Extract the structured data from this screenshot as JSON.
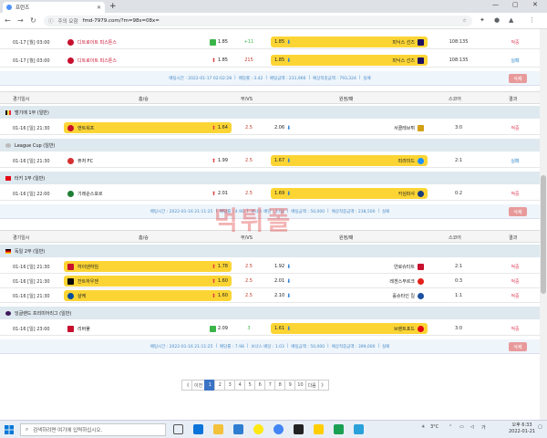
{
  "browser": {
    "tab_title": "프런즈",
    "new_tab": "+",
    "security_label": "주의 요함",
    "url": "fmd-7979.com/?m=98s=08x=",
    "win_min": "—",
    "win_max": "▢",
    "win_close": "✕"
  },
  "top_rows": [
    {
      "date": "01-17 [월] 03:00",
      "home": "디트로이트 피스톤스",
      "home_odds": "1.85",
      "draw": "+11",
      "away_odds": "1.85",
      "away": "피닉스 선즈",
      "score": "108:135",
      "result": "적중",
      "result_color": "red"
    },
    {
      "date": "01-17 [월] 03:00",
      "home": "디트로이트 피스톤스",
      "home_odds": "1.85",
      "draw": "215",
      "away_odds": "1.85",
      "away": "피닉스 선즈",
      "score": "108:135",
      "result": "실패",
      "result_color": "blue"
    }
  ],
  "summary1": {
    "time": "배팅시간 : 2022-01-17 02:02:28",
    "rate": "배당률 : 3.42",
    "amount": "배팅금액 : 231,966",
    "expected": "예상적중금액 : 793,324",
    "status": "실패",
    "delete": "삭제"
  },
  "header": {
    "date": "경기일시",
    "home": "홈/승",
    "draw": "무/VS",
    "away": "원정/패",
    "score": "스코어",
    "result": "결과"
  },
  "block2": {
    "leagues": [
      {
        "name": "벨기에 1부 (일반)",
        "color": "#222",
        "row": {
          "date": "01-16 [일] 21:30",
          "home": "앤트워프",
          "home_odds": "1.64",
          "draw": "2.5",
          "away_odds": "2.06",
          "away": "서클레브뤼",
          "score": "3:0",
          "result": "적중",
          "result_color": "red",
          "home_y": true,
          "away_y": false
        }
      },
      {
        "name": "League Cup (일반)",
        "color": "#777",
        "row": {
          "date": "01-16 [일] 21:30",
          "home": "퓨처 FC",
          "home_odds": "1.99",
          "draw": "2.5",
          "away_odds": "1.67",
          "away": "피라미드",
          "score": "2:1",
          "result": "실패",
          "result_color": "blue",
          "home_y": false,
          "away_y": true
        }
      },
      {
        "name": "터키 1부 (일반)",
        "color": "#e30a17",
        "row": {
          "date": "01-16 [일] 22:00",
          "home": "기레순스포르",
          "home_odds": "2.01",
          "draw": "2.5",
          "away_odds": "1.69",
          "away": "카심파샤",
          "score": "0:2",
          "result": "적중",
          "result_color": "red",
          "home_y": false,
          "away_y": true
        }
      }
    ],
    "summary": {
      "time": "배팅시간 : 2022-01-16 21:11:25",
      "rate": "배당률 : 4.90",
      "bonus": "보너스 배당 : 1.03",
      "amount": "배팅금액 : 50,000",
      "expected": "예상적중금액 : 238,500",
      "status": "실패",
      "delete": "삭제"
    }
  },
  "block3": {
    "league1": {
      "name": "독일 2부 (일반)",
      "color": "#dd0000"
    },
    "rows1": [
      {
        "date": "01-16 [일] 21:30",
        "home": "하이덴하임",
        "home_odds": "1.78",
        "draw": "2.5",
        "away_odds": "1.92",
        "away": "얀로슈타트",
        "score": "2:1",
        "result": "적중",
        "result_color": "red",
        "home_y": true,
        "away_y": false
      },
      {
        "date": "01-16 [일] 21:30",
        "home": "잔트하우젠",
        "home_odds": "1.60",
        "draw": "2.5",
        "away_odds": "2.01",
        "away": "레겐스부르크",
        "score": "0:3",
        "result": "적중",
        "result_color": "red",
        "home_y": true,
        "away_y": false
      },
      {
        "date": "01-16 [일] 21:30",
        "home": "샬케",
        "home_odds": "1.60",
        "draw": "2.5",
        "away_odds": "2.10",
        "away": "홀슈타인 킬",
        "score": "1:1",
        "result": "적중",
        "result_color": "red",
        "home_y": true,
        "away_y": false
      }
    ],
    "league2": {
      "name": "잉글랜드 프리미어리그 (일반)",
      "color": "#3d195b"
    },
    "rows2": [
      {
        "date": "01-16 [일] 23:00",
        "home": "리버풀",
        "home_odds": "2.09",
        "draw": "3",
        "away_odds": "1.61",
        "away": "브렌트포드",
        "score": "3:0",
        "result": "적중",
        "result_color": "red",
        "home_y": false,
        "away_y": true
      }
    ],
    "summary": {
      "time": "배팅시간 : 2022-01-16 21:11:25",
      "rate": "배당률 : 7.98",
      "bonus": "보너스 배당 : 1.03",
      "amount": "배팅금액 : 50,000",
      "expected": "예상적중금액 : 399,000",
      "status": "실패",
      "delete": "삭제"
    }
  },
  "pager": {
    "first": "《",
    "prev": "이전",
    "pages": [
      "1",
      "2",
      "3",
      "4",
      "5",
      "6",
      "7",
      "8",
      "9",
      "10"
    ],
    "active": "1",
    "next": "다음",
    "last": "》"
  },
  "watermark": "먹튀폴",
  "taskbar": {
    "search_placeholder": "검색하려면 여기에 입력하십시오.",
    "weather": "3°C",
    "time": "오후 6:33",
    "date": "2022-01-21"
  }
}
